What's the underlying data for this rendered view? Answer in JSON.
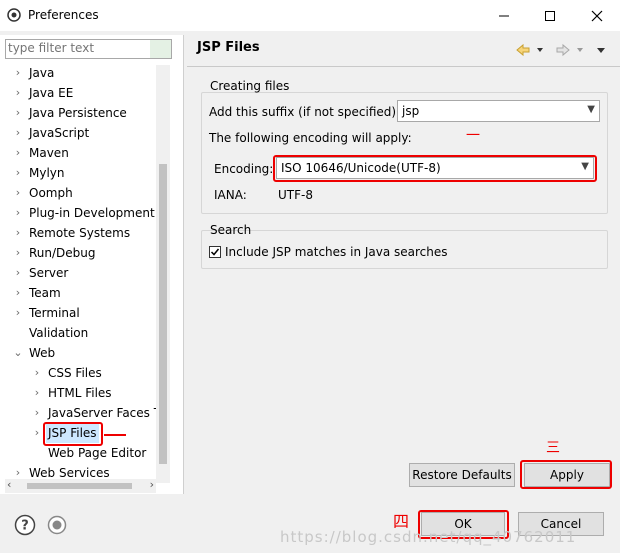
{
  "window": {
    "title": "Preferences"
  },
  "filter": {
    "placeholder": "type filter text"
  },
  "tree": {
    "items": [
      {
        "label": "Java",
        "expandable": true
      },
      {
        "label": "Java EE",
        "expandable": true
      },
      {
        "label": "Java Persistence",
        "expandable": true
      },
      {
        "label": "JavaScript",
        "expandable": true
      },
      {
        "label": "Maven",
        "expandable": true
      },
      {
        "label": "Mylyn",
        "expandable": true
      },
      {
        "label": "Oomph",
        "expandable": true
      },
      {
        "label": "Plug-in Development",
        "expandable": true
      },
      {
        "label": "Remote Systems",
        "expandable": true
      },
      {
        "label": "Run/Debug",
        "expandable": true
      },
      {
        "label": "Server",
        "expandable": true
      },
      {
        "label": "Team",
        "expandable": true
      },
      {
        "label": "Terminal",
        "expandable": true
      },
      {
        "label": "Validation",
        "expandable": false
      },
      {
        "label": "Web",
        "expandable": true,
        "expanded": true
      },
      {
        "label": "CSS Files",
        "expandable": true,
        "child": true
      },
      {
        "label": "HTML Files",
        "expandable": true,
        "child": true
      },
      {
        "label": "JavaServer Faces T",
        "expandable": true,
        "child": true
      },
      {
        "label": "JSP Files",
        "expandable": true,
        "child": true,
        "selected": true
      },
      {
        "label": "Web Page Editor",
        "expandable": false,
        "child": true
      },
      {
        "label": "Web Services",
        "expandable": true
      }
    ]
  },
  "page": {
    "title": "JSP Files"
  },
  "creating_files": {
    "title": "Creating files",
    "suffix_label": "Add this suffix (if not specified):",
    "suffix_value": "jsp",
    "encoding_note": "The following encoding will apply:",
    "encoding_label": "Encoding:",
    "encoding_value": "ISO 10646/Unicode(UTF-8)",
    "iana_label": "IANA:",
    "iana_value": "UTF-8"
  },
  "search": {
    "title": "Search",
    "include_label": "Include JSP matches in Java searches",
    "include_checked": true
  },
  "buttons": {
    "restore": "Restore Defaults",
    "apply": "Apply",
    "ok": "OK",
    "cancel": "Cancel"
  },
  "annotations": {
    "one": "一",
    "two": "二",
    "three": "三",
    "four": "四"
  },
  "watermark": "https://blog.csdn.net/qq_40762011",
  "colors": {
    "annotation_red": "#e00000",
    "selection": "#cde8ff"
  }
}
